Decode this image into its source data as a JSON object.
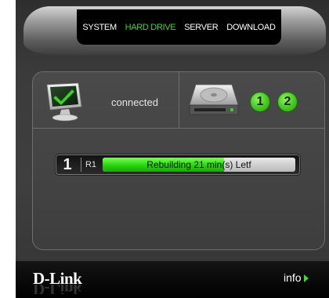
{
  "nav": {
    "items": [
      {
        "label": "SYSTEM",
        "active": false
      },
      {
        "label": "HARD DRIVE",
        "active": true
      },
      {
        "label": "SERVER",
        "active": false
      },
      {
        "label": "DOWNLOAD",
        "active": false
      }
    ]
  },
  "status": {
    "icon": "monitor-check-icon",
    "text": "connected"
  },
  "drives": {
    "icon": "hard-drive-icon",
    "badges": [
      "1",
      "2"
    ]
  },
  "progress": {
    "disk": "1",
    "raid": "R1",
    "text": "Rebuilding 21 min(s) Letf",
    "fill_percent": 63
  },
  "footer": {
    "logo": "D-Link",
    "info_label": "info"
  },
  "colors": {
    "accent_green": "#43d43a",
    "bar_green": "#29d40f"
  }
}
